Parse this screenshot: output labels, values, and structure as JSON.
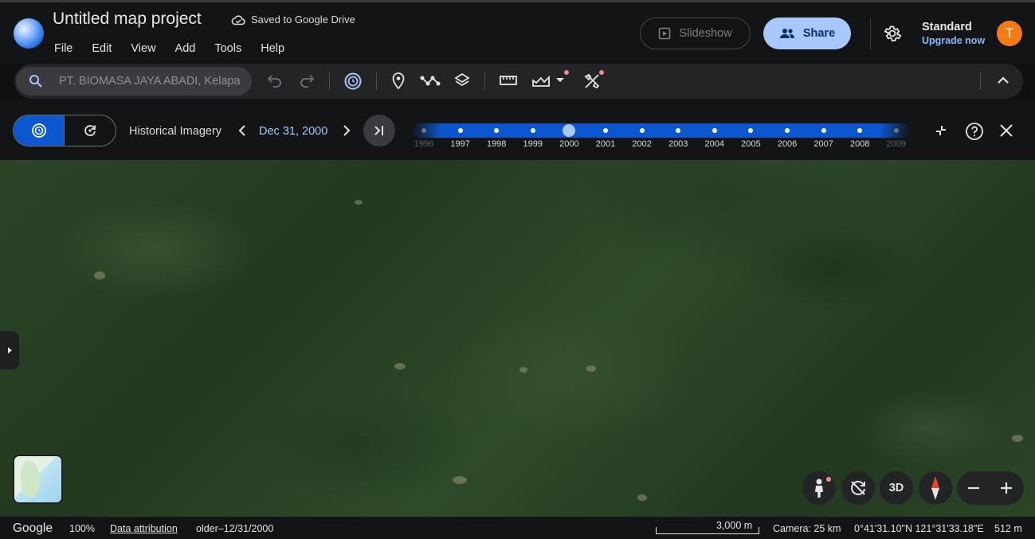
{
  "header": {
    "title": "Untitled map project",
    "saved_status": "Saved to Google Drive",
    "menu": [
      "File",
      "Edit",
      "View",
      "Add",
      "Tools",
      "Help"
    ],
    "slideshow_label": "Slideshow",
    "share_label": "Share",
    "plan_name": "Standard",
    "upgrade_label": "Upgrade now",
    "avatar_initial": "T"
  },
  "toolbar": {
    "search_value": "PT. BIOMASA JAYA ABADI, Kelapa"
  },
  "historical": {
    "label": "Historical Imagery",
    "date": "Dec 31, 2000",
    "timeline": {
      "years": [
        "1996",
        "1997",
        "1998",
        "1999",
        "2000",
        "2001",
        "2002",
        "2003",
        "2004",
        "2005",
        "2006",
        "2007",
        "2008",
        "2009"
      ],
      "selected": "2000"
    }
  },
  "footer": {
    "brand": "Google",
    "zoom": "100%",
    "attribution": "Data attribution",
    "imagery_date": "older–12/31/2000",
    "scale": "3,000 m",
    "camera": "Camera: 25 km",
    "coordinates": "0°41'31.10\"N 121°31'33.18\"E",
    "elevation": "512 m"
  },
  "map_controls": {
    "mode_3d_label": "3D"
  },
  "colors": {
    "accent": "#a8c7fa",
    "primary_blue": "#0b57d0",
    "avatar": "#f27b13",
    "notification_dot": "#f28b82",
    "background": "#131416"
  },
  "icons": [
    "globe-logo",
    "cloud-icon",
    "slideshow-icon",
    "people-icon",
    "gear-icon",
    "search-icon",
    "undo-icon",
    "redo-icon",
    "historical-imagery-icon",
    "placemark-icon",
    "path-icon",
    "layers-icon",
    "ruler-icon",
    "terrain-icon",
    "satellite-tools-icon",
    "collapse-icon",
    "help-icon",
    "close-icon",
    "pegman-icon",
    "rotate-icon",
    "compass-icon"
  ]
}
